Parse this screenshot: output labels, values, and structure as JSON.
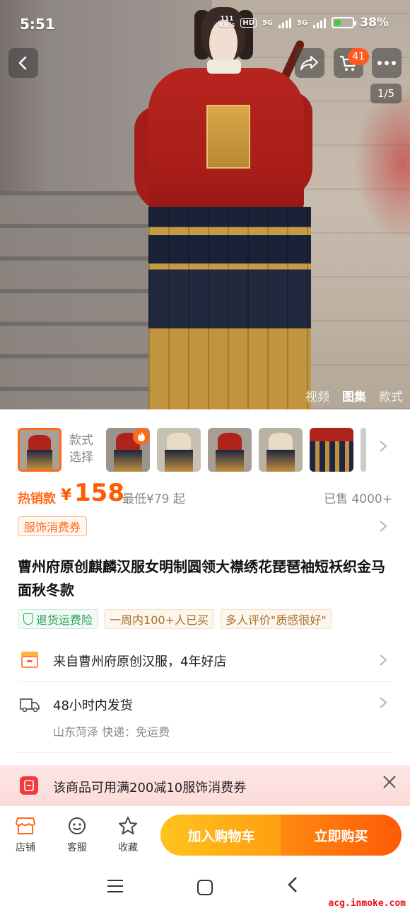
{
  "status_bar": {
    "time": "5:51",
    "net_speed_value": "111",
    "net_speed_unit": "KB/s",
    "hd_label": "HD",
    "sim1_label": "5G",
    "sim2_label": "5G",
    "battery_percent": "38%",
    "battery_level": 0.38
  },
  "gallery": {
    "image_counter": "1/5",
    "cart_badge_count": "41",
    "media_tabs": [
      "视频",
      "图集",
      "款式"
    ],
    "active_tab": "图集"
  },
  "style_selector": {
    "label_line1": "款式",
    "label_line2": "选择",
    "hot_icon": "flame-icon"
  },
  "price": {
    "hot_label": "热销款",
    "currency": "¥",
    "value": "158",
    "lowest": "最低¥79 起",
    "sold": "已售 4000+"
  },
  "coupon_tag": "服饰消费券",
  "product_title": "曹州府原创麒麟汉服女明制圆领大襟绣花琵琶袖短袄织金马面秋冬款",
  "tags": [
    "退货运费险",
    "一周内100+人已买",
    "多人评价\"质感很好\""
  ],
  "shop_row": {
    "text": "来自曹州府原创汉服，4年好店"
  },
  "shipping_row": {
    "text": "48小时内发货",
    "sub": "山东菏泽  快递：免运费"
  },
  "promo_banner": {
    "text": "该商品可用满200减10服饰消费券"
  },
  "bottom_bar": {
    "shop": "店铺",
    "service": "客服",
    "favorite": "收藏",
    "add_to_cart": "加入购物车",
    "buy_now": "立即购买"
  },
  "watermark": "acg.inmoke.com",
  "colors": {
    "accent": "#ff5a00",
    "buy_button": "#ff5a06",
    "cart_button": "#ffb41a"
  }
}
